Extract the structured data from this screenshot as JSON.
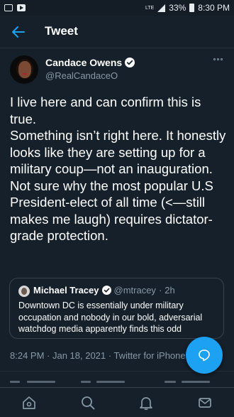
{
  "status_bar": {
    "network": "LTE",
    "battery": "33%",
    "time": "8:30 PM"
  },
  "header": {
    "title": "Tweet",
    "back_icon": "arrow-left-icon"
  },
  "author": {
    "name": "Candace Owens",
    "handle": "@RealCandaceO",
    "verified": true
  },
  "tweet": {
    "lines": [
      "I live here and can confirm this is true.",
      "Something isn’t right here. It honestly looks like they are setting up for a military coup—not an inauguration.",
      "Not sure why the most popular U.S President-elect of all time (<—still makes me laugh) requires dictator-grade protection."
    ]
  },
  "quote": {
    "name": "Michael Tracey",
    "handle": "@mtracey",
    "separator": "·",
    "time": "2h",
    "text": "Downtown DC is essentially under military occupation and nobody in our bold, adversarial watchdog media apparently finds this odd"
  },
  "meta": {
    "timestamp": "8:24 PM · Jan 18, 2021 · Twitter for iPhone"
  },
  "bottom_nav": {
    "items": [
      "home-icon",
      "search-icon",
      "notifications-icon",
      "messages-icon"
    ]
  },
  "colors": {
    "background": "#15202b",
    "accent": "#1da1f2",
    "secondary_text": "#8899a6",
    "border": "#38444d"
  }
}
